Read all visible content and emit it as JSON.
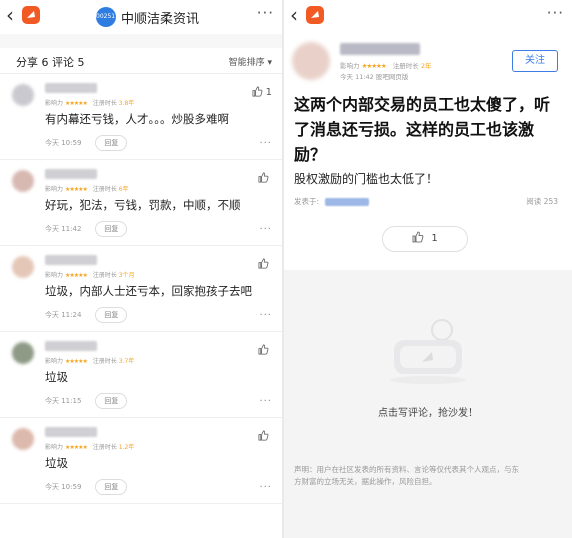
{
  "left": {
    "stock_code": "002511",
    "stock_name": "中顺洁柔资讯",
    "counts": "分享 6   评论 5",
    "sort_label": "智能排序 ▾",
    "meta_influence": "影响力",
    "meta_stars": "★★★★★",
    "meta_duration_label": "注册时长",
    "reply_label": "回复",
    "comments": [
      {
        "text": "有内幕还亏钱，人才。。。炒股多难啊",
        "duration": "3.8年",
        "time": "今天 10:59",
        "likes": "1",
        "avatar_color": "#c9c9cf"
      },
      {
        "text": "好玩，犯法，亏钱，罚款，中顺，不顺",
        "duration": "6年",
        "time": "今天 11:42",
        "likes": "",
        "avatar_color": "#d7b9b2"
      },
      {
        "text": "垃圾，内部人士还亏本，回家抱孩子去吧",
        "duration": "3个月",
        "time": "今天 11:24",
        "likes": "",
        "avatar_color": "#e4c7b7"
      },
      {
        "text": "垃圾",
        "duration": "3.7年",
        "time": "今天 11:15",
        "likes": "",
        "avatar_color": "#8f9a86"
      },
      {
        "text": "垃圾",
        "duration": "1.2年",
        "time": "今天 10:59",
        "likes": "",
        "avatar_color": "#dcb9ad"
      }
    ]
  },
  "right": {
    "follow_label": "关注",
    "meta_influence": "影响力",
    "meta_stars": "★★★★★",
    "meta_duration_label": "注册时长",
    "meta_duration": "2年",
    "post_time": "今天 11:42 股吧网页版",
    "title": "这两个内部交易的员工也太傻了，听了消息还亏损。这样的员工也该激励？",
    "body": "股权激励的门槛也太低了！",
    "source_label": "发表于:",
    "reads": "阅读 253",
    "likes": "1",
    "empty_text": "点击写评论，抢沙发！",
    "disclaimer": "声明：用户在社区发表的所有资料、言论等仅代表其个人观点，与东方财富的立场无关，据此操作，风险自担。"
  }
}
